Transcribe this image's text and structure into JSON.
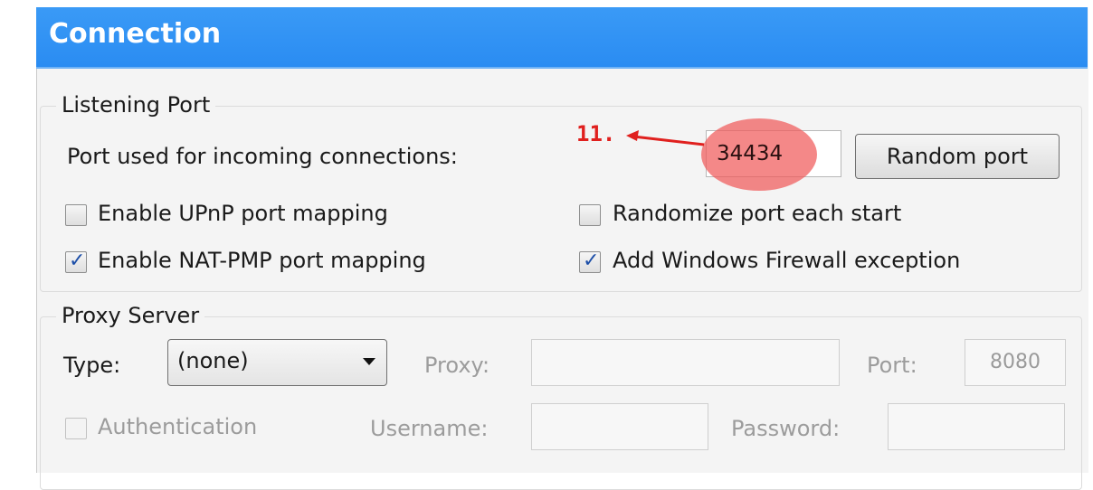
{
  "header": {
    "title": "Connection"
  },
  "listening_port": {
    "group_title": "Listening Port",
    "port_label": "Port used for incoming connections:",
    "port_value": "34434",
    "random_button": "Random port",
    "upnp": {
      "label": "Enable UPnP port mapping",
      "checked": false
    },
    "natpmp": {
      "label": "Enable NAT-PMP port mapping",
      "checked": true
    },
    "randomize": {
      "label": "Randomize port each start",
      "checked": false
    },
    "firewall": {
      "label": "Add Windows Firewall exception",
      "checked": true
    }
  },
  "proxy": {
    "group_title": "Proxy Server",
    "type_label": "Type:",
    "type_value": "(none)",
    "proxy_label": "Proxy:",
    "port_label": "Port:",
    "port_value": "8080",
    "auth_label": "Authentication",
    "auth_checked": false,
    "username_label": "Username:",
    "password_label": "Password:"
  },
  "annotation": {
    "step": "11.",
    "color": "#e0201e"
  }
}
